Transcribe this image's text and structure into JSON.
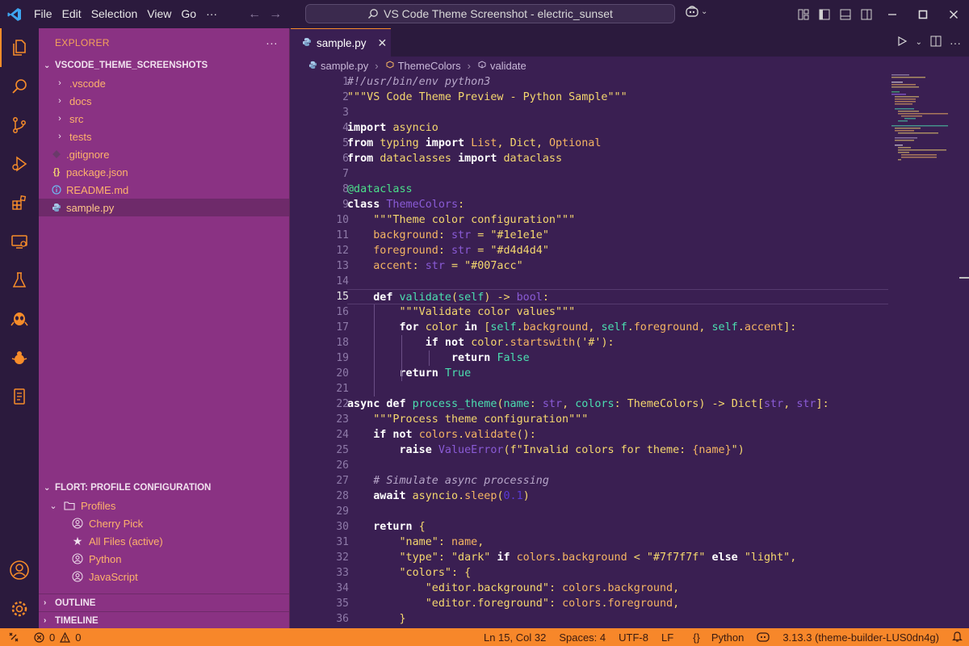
{
  "titlebar": {
    "menu": [
      "File",
      "Edit",
      "Selection",
      "View",
      "Go",
      "···"
    ],
    "search_text": "VS Code Theme Screenshot - electric_sunset"
  },
  "sidebar": {
    "title": "EXPLORER",
    "more": "···",
    "project": "VSCODE_THEME_SCREENSHOTS",
    "items": [
      {
        "label": ".vscode",
        "kind": "folder"
      },
      {
        "label": "docs",
        "kind": "folder"
      },
      {
        "label": "src",
        "kind": "folder"
      },
      {
        "label": "tests",
        "kind": "folder"
      },
      {
        "label": ".gitignore",
        "kind": "gitignore"
      },
      {
        "label": "package.json",
        "kind": "json"
      },
      {
        "label": "README.md",
        "kind": "info"
      },
      {
        "label": "sample.py",
        "kind": "python",
        "selected": true
      }
    ],
    "flort_title": "FLORT: PROFILE CONFIGURATION",
    "profiles_label": "Profiles",
    "profiles": [
      {
        "label": "Cherry Pick",
        "icon": "account-icon"
      },
      {
        "label": "All Files (active)",
        "icon": "star-icon"
      },
      {
        "label": "Python",
        "icon": "account-icon"
      },
      {
        "label": "JavaScript",
        "icon": "account-icon"
      }
    ],
    "outline": "OUTLINE",
    "timeline": "TIMELINE"
  },
  "editor": {
    "tab_label": "sample.py",
    "breadcrumb": [
      "sample.py",
      "ThemeColors",
      "validate"
    ],
    "current_line": 15
  },
  "statusbar": {
    "errors": "0",
    "warnings": "0",
    "position": "Ln 15, Col 32",
    "spaces": "Spaces: 4",
    "encoding": "UTF-8",
    "eol": "LF",
    "language": "Python",
    "version": "3.13.3 (theme-builder-LUS0dn4g)"
  },
  "colors": {
    "accent": "#f7872a",
    "sidebar_bg": "#8a3283",
    "editor_bg": "#3a1f52",
    "titlebar_bg": "#2b1a3d"
  }
}
